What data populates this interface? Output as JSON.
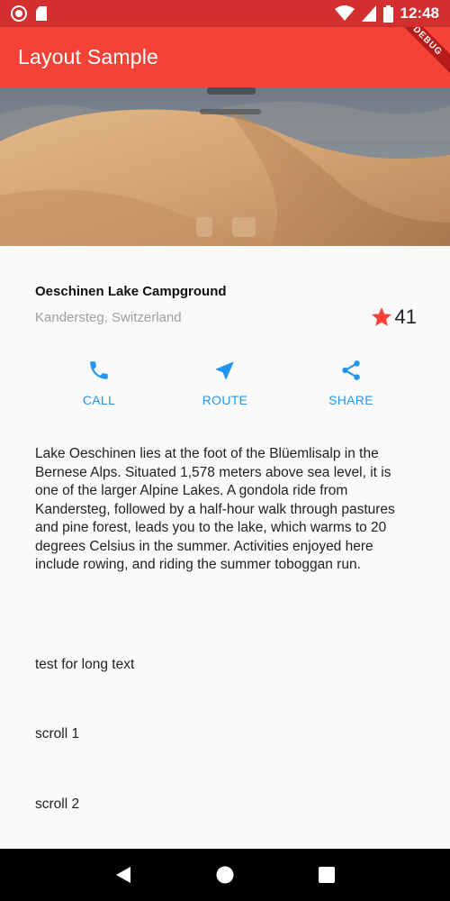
{
  "status_bar": {
    "time": "12:48",
    "icons": [
      "record-icon",
      "sd-card-icon",
      "wifi-icon",
      "signal-icon",
      "battery-icon"
    ]
  },
  "app_bar": {
    "title": "Layout Sample",
    "debug_banner": "DEBUG"
  },
  "place": {
    "name": "Oeschinen Lake Campground",
    "location": "Kandersteg, Switzerland",
    "rating_count": "41"
  },
  "actions": [
    {
      "label": "CALL",
      "icon": "phone-icon"
    },
    {
      "label": "ROUTE",
      "icon": "navigation-icon"
    },
    {
      "label": "SHARE",
      "icon": "share-icon"
    }
  ],
  "description": "Lake Oeschinen lies at the foot of the Blüemlisalp in the Bernese Alps. Situated 1,578 meters above sea level, it is one of the larger Alpine Lakes. A gondola ride from Kandersteg, followed by a half-hour walk through pastures and pine forest, leads you to the lake, which warms to 20 degrees Celsius in the summer. Activities enjoyed here include rowing, and riding the summer toboggan run.",
  "extra": {
    "long_text": "test for long text",
    "scroll1": "scroll 1",
    "scroll2": "scroll 2"
  },
  "colors": {
    "app_bar": "#f44336",
    "status_bar": "#d32f2f",
    "accent": "#2196f3",
    "star": "#f44336"
  }
}
